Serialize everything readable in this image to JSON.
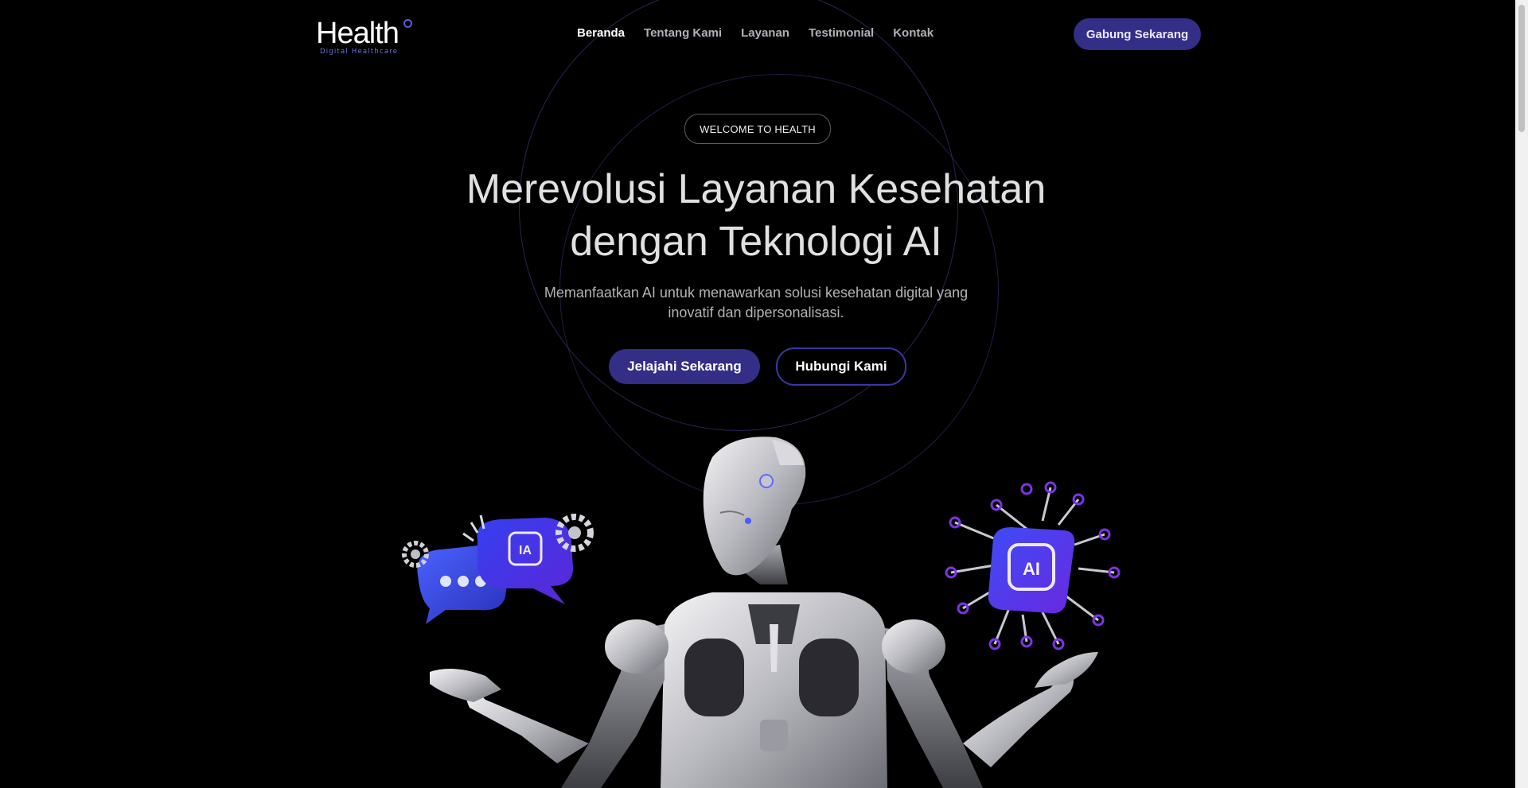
{
  "header": {
    "logo_text": "Health",
    "logo_tagline": "Digital Healthcare",
    "nav": [
      {
        "label": "Beranda",
        "active": true
      },
      {
        "label": "Tentang Kami",
        "active": false
      },
      {
        "label": "Layanan",
        "active": false
      },
      {
        "label": "Testimonial",
        "active": false
      },
      {
        "label": "Kontak",
        "active": false
      }
    ],
    "cta_label": "Gabung Sekarang"
  },
  "hero": {
    "badge": "WELCOME TO HEALTH",
    "title_line1": "Merevolusi Layanan Kesehatan",
    "title_line2": "dengan Teknologi AI",
    "subtitle": "Memanfaatkan AI untuk menawarkan solusi kesehatan digital yang inovatif dan dipersonalisasi.",
    "primary_button": "Jelajahi Sekarang",
    "secondary_button": "Hubungi Kami",
    "illustration": {
      "left_chip_label": "IA",
      "right_chip_label": "AI"
    }
  },
  "colors": {
    "background": "#000000",
    "accent": "#332f86",
    "logo_accent": "#6f6fe0",
    "chip_blue": "#2f3fd8",
    "chip_purple": "#7b2fe0"
  },
  "icons": [
    "gear-icon",
    "chat-bubble-icon",
    "chip-icon",
    "robot-illustration"
  ]
}
